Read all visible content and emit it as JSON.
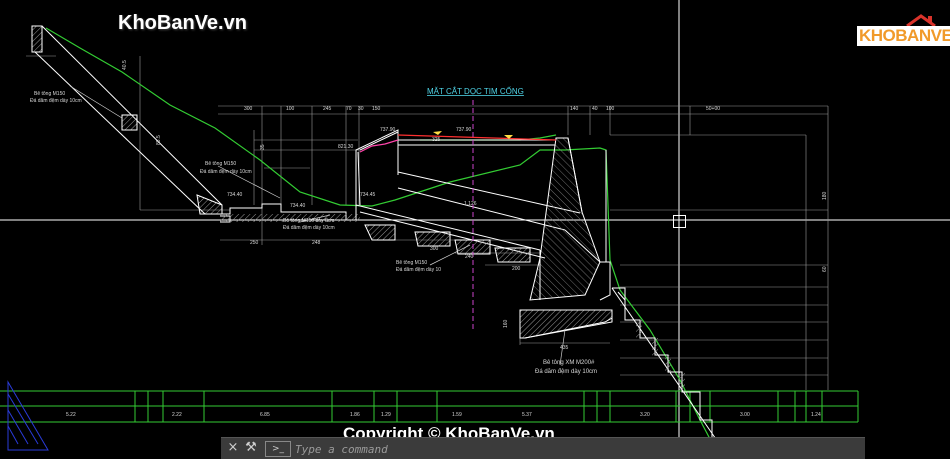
{
  "watermark": {
    "site": "KhoBanVe.vn",
    "logo": "KHOBANVE",
    "copyright": "Copyright © KhoBanVe.vn"
  },
  "drawing": {
    "title": "MẶT CẮT DỌC TIM CỐNG",
    "notes": {
      "top_left_1": "Bê tông M150",
      "top_left_2": "Đá dăm đệm dày 10cm",
      "mid_left_1": "Bê tông M150",
      "mid_left_2": "Đá dăm đệm dày 10cm",
      "mid_1": "Bê tông M150 dày 8cm",
      "mid_2": "Đá dăm đệm dày 10cm",
      "center_1": "Bê tông M150",
      "center_2": "Đá dăm đệm dày 10",
      "bottom_1": "Bê tông XM M200#",
      "bottom_2": "Đá dăm đệm dày 10cm"
    },
    "elevations": {
      "e1": "737.90",
      "e2": "737.90",
      "e3": "821.30",
      "e4": "734.40",
      "e5": "734.40",
      "e6": "734.45"
    },
    "dims_top": [
      "300",
      "100",
      "245",
      "70",
      "30",
      "150",
      "140",
      "40",
      "100",
      "50+00"
    ],
    "dims_mid": [
      "250",
      "248",
      "300",
      "240",
      "200",
      "435",
      "325",
      "1.126"
    ],
    "dims_vertical": [
      "40.5",
      "88.5",
      "35",
      "180",
      "60",
      "160"
    ],
    "table_row": [
      "5.22",
      "2.22",
      "6.85",
      "1.86",
      "1.29",
      "1.59",
      "5.37",
      "3.20",
      "3.00",
      "1.24"
    ]
  },
  "command_line": {
    "placeholder": "Type a command",
    "close_label": "×",
    "customize_label": "⚒",
    "prompt_label": ">_"
  },
  "colors": {
    "background": "#000000",
    "structure": "#ffffff",
    "ground": "#33cc33",
    "dimension": "#c8c8c8",
    "title": "#4fd3e6",
    "water_pipe": "#ff3030",
    "ucs": "#2a3bd9"
  }
}
